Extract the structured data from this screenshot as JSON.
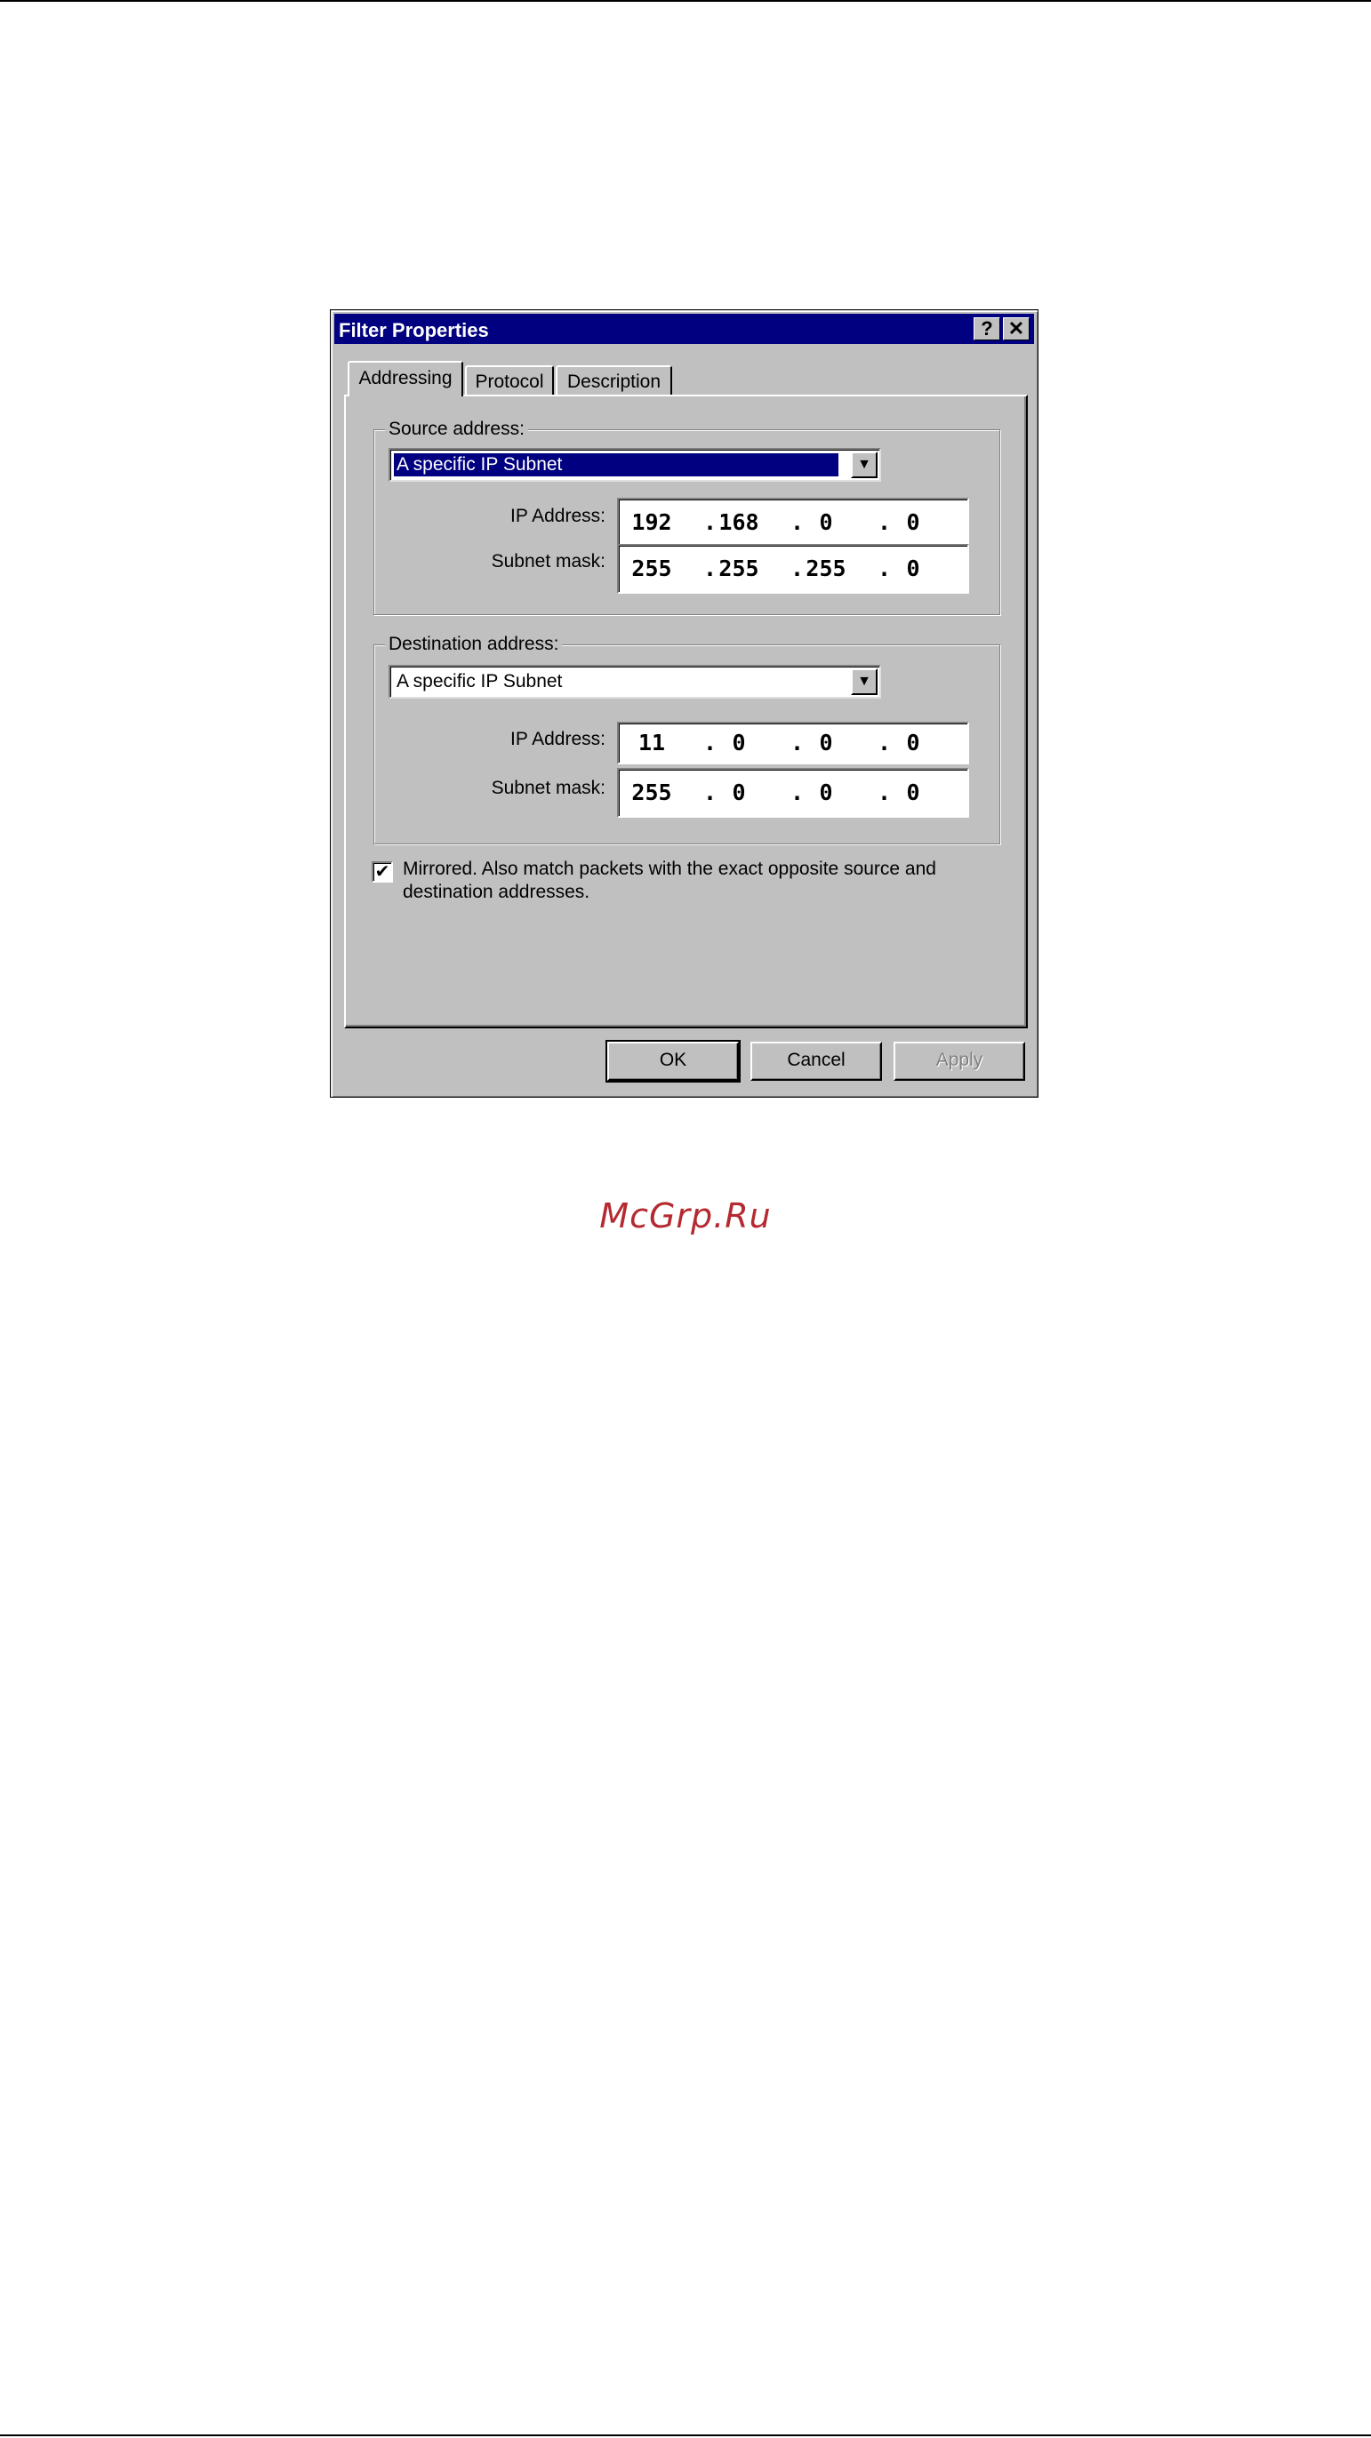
{
  "window": {
    "title": "Filter Properties",
    "help_icon": "?",
    "close_icon": "✕"
  },
  "tabs": [
    {
      "label": "Addressing",
      "active": true
    },
    {
      "label": "Protocol",
      "active": false
    },
    {
      "label": "Description",
      "active": false
    }
  ],
  "source": {
    "group_label": "Source address:",
    "combo_value": "A specific IP Subnet",
    "ip_label": "IP Address:",
    "ip_octets": [
      "192",
      "168",
      "0",
      "0"
    ],
    "mask_label": "Subnet mask:",
    "mask_octets": [
      "255",
      "255",
      "255",
      "0"
    ]
  },
  "destination": {
    "group_label": "Destination address:",
    "combo_value": "A specific IP Subnet",
    "ip_label": "IP Address:",
    "ip_octets": [
      "11",
      "0",
      "0",
      "0"
    ],
    "mask_label": "Subnet mask:",
    "mask_octets": [
      "255",
      "0",
      "0",
      "0"
    ]
  },
  "mirrored": {
    "checked": true,
    "check_glyph": "✔",
    "label": "Mirrored. Also match packets with the exact opposite source and destination addresses."
  },
  "buttons": {
    "ok": "OK",
    "cancel": "Cancel",
    "apply": "Apply"
  },
  "dropdown_arrow": "▼",
  "ip_separator": ".",
  "watermark": "McGrp.Ru",
  "colors": {
    "titlebar": "#000080",
    "dialog_face": "#c0c0c0",
    "watermark": "#b52a30"
  }
}
